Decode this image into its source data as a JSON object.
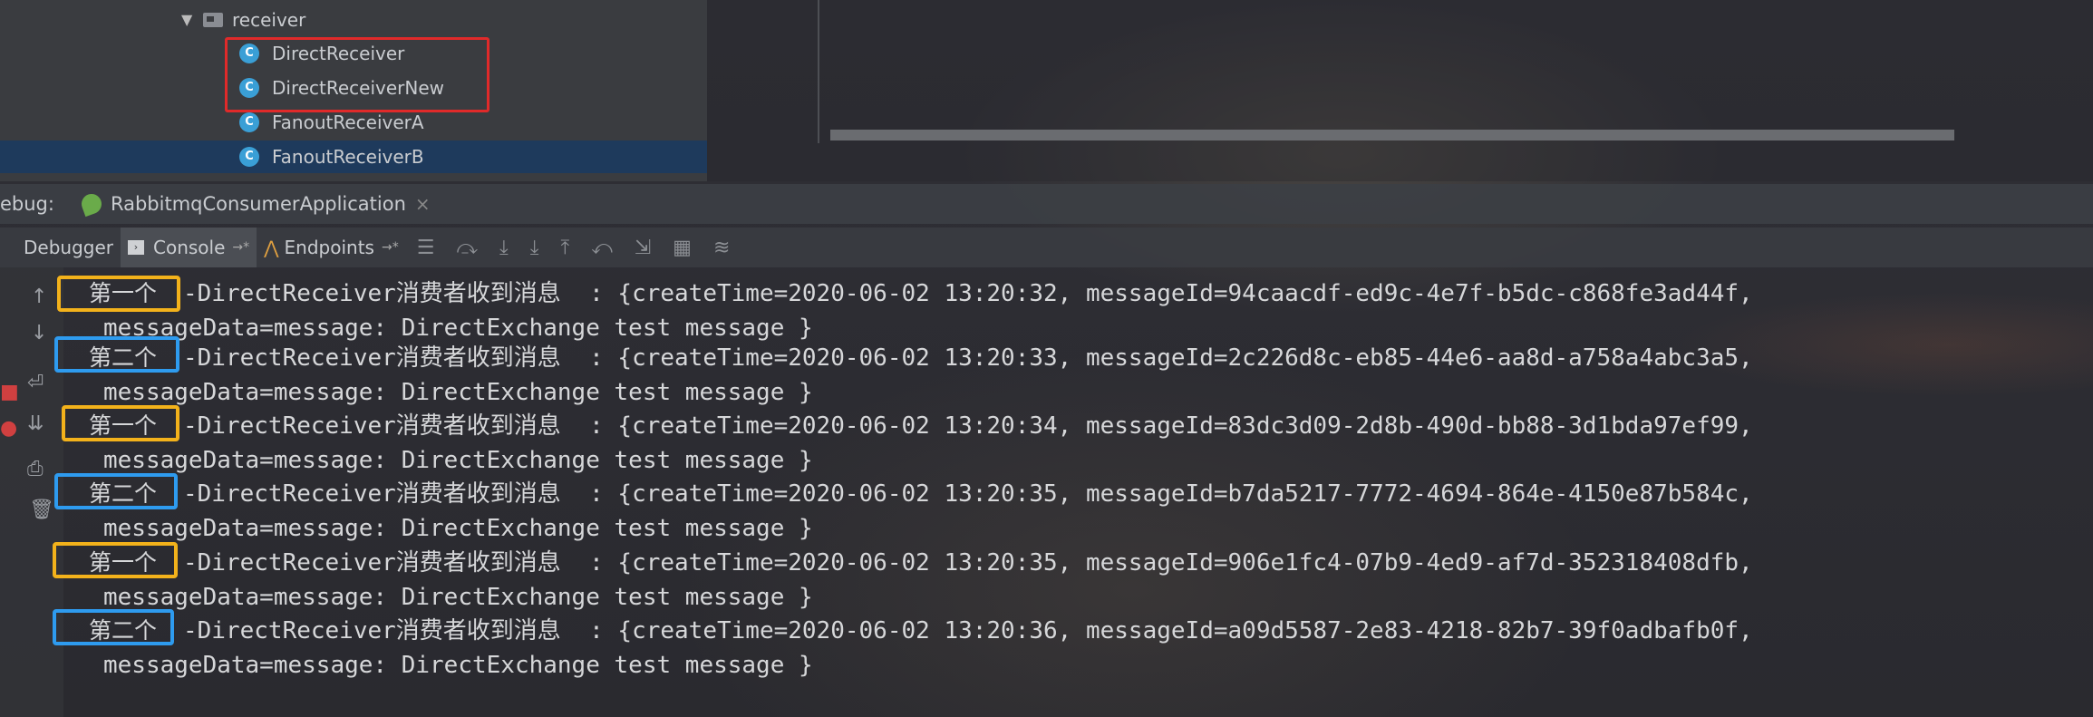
{
  "tree": {
    "folder": "receiver",
    "items": [
      "DirectReceiver",
      "DirectReceiverNew",
      "FanoutReceiverA",
      "FanoutReceiverB"
    ],
    "class_icon_letter": "C"
  },
  "debug": {
    "label": "ebug:",
    "run_config": "RabbitmqConsumerApplication",
    "close_symbol": "×"
  },
  "toolbar": {
    "debugger": "Debugger",
    "console": "Console",
    "endpoints": "Endpoints",
    "pin": "→*"
  },
  "log": {
    "entries": [
      {
        "tag": "第一个",
        "tag_color": "#f3b21b",
        "line1": "-DirectReceiver消费者收到消息  : {createTime=2020-06-02 13:20:32, messageId=94caacdf-ed9c-4e7f-b5dc-c868fe3ad44f,",
        "line2": "messageData=message: DirectExchange test message }"
      },
      {
        "tag": "第二个",
        "tag_color": "#2e9bef",
        "line1": "-DirectReceiver消费者收到消息  : {createTime=2020-06-02 13:20:33, messageId=2c226d8c-eb85-44e6-aa8d-a758a4abc3a5,",
        "line2": "messageData=message: DirectExchange test message }"
      },
      {
        "tag": "第一个",
        "tag_color": "#f3b21b",
        "line1": "-DirectReceiver消费者收到消息  : {createTime=2020-06-02 13:20:34, messageId=83dc3d09-2d8b-490d-bb88-3d1bda97ef99,",
        "line2": "messageData=message: DirectExchange test message }"
      },
      {
        "tag": "第二个",
        "tag_color": "#2e9bef",
        "line1": "-DirectReceiver消费者收到消息  : {createTime=2020-06-02 13:20:35, messageId=b7da5217-7772-4694-864e-4150e87b584c,",
        "line2": "messageData=message: DirectExchange test message }"
      },
      {
        "tag": "第一个",
        "tag_color": "#f3b21b",
        "line1": "-DirectReceiver消费者收到消息  : {createTime=2020-06-02 13:20:35, messageId=906e1fc4-07b9-4ed9-af7d-352318408dfb,",
        "line2": "messageData=message: DirectExchange test message }"
      },
      {
        "tag": "第二个",
        "tag_color": "#2e9bef",
        "line1": "-DirectReceiver消费者收到消息  : {createTime=2020-06-02 13:20:36, messageId=a09d5587-2e83-4218-82b7-39f0adbafb0f,",
        "line2": "messageData=message: DirectExchange test message }"
      }
    ]
  },
  "colors": {
    "highlight_red": "#e02a2a",
    "tag_yellow": "#f3b21b",
    "tag_blue": "#2e9bef",
    "selection": "#1e3a5c"
  }
}
